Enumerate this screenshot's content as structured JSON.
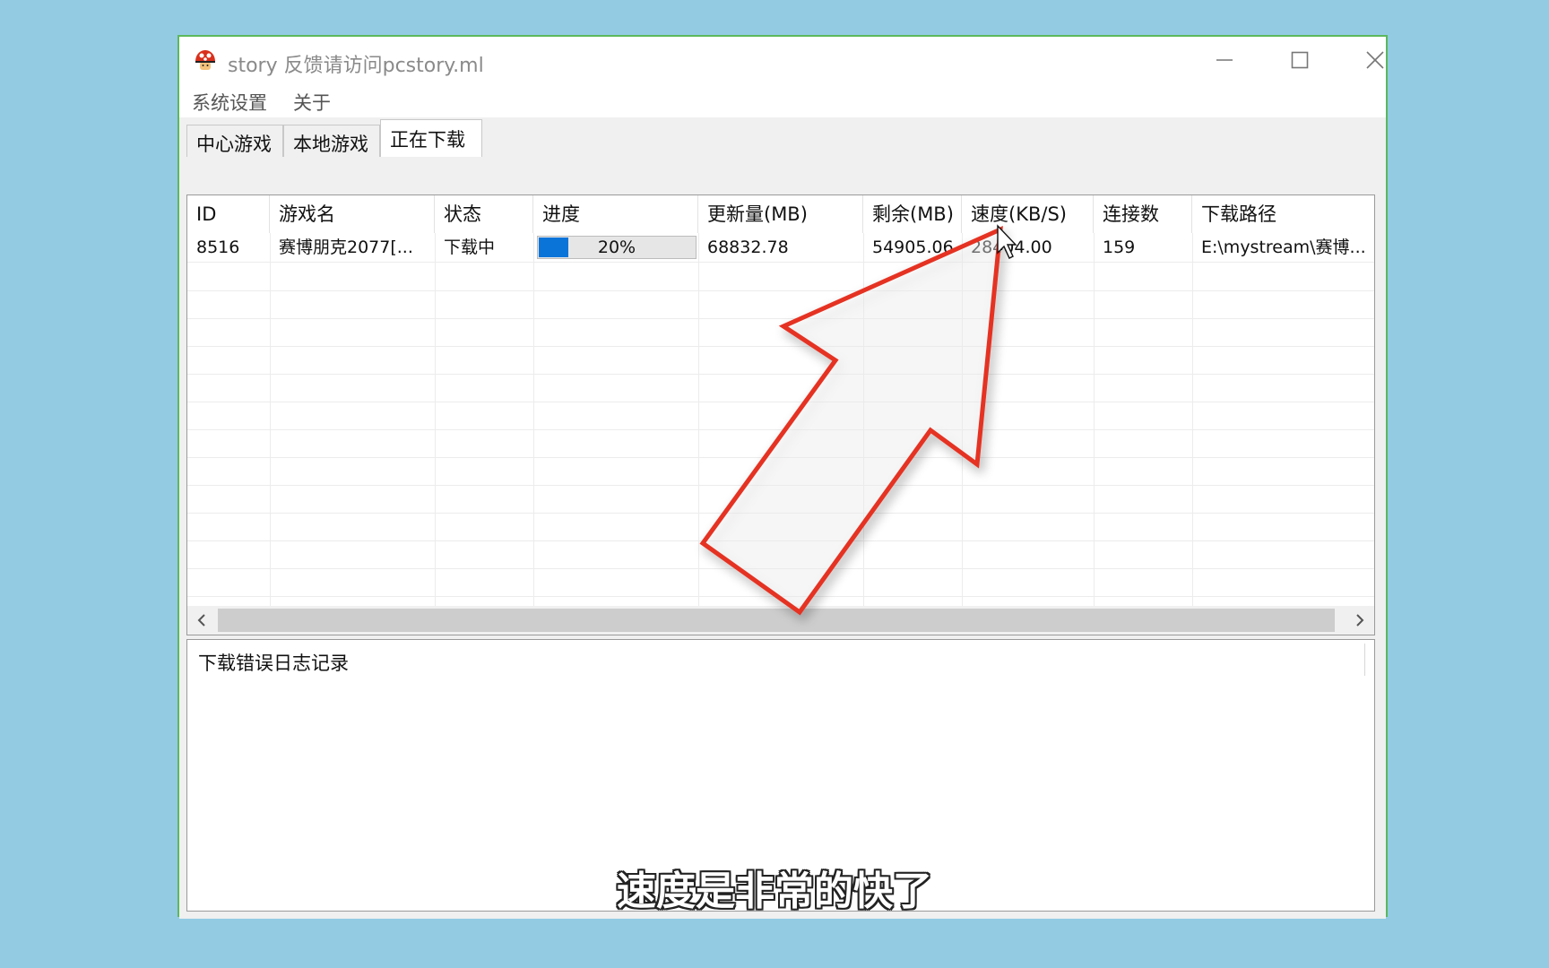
{
  "window": {
    "title": "story 反馈请访问pcstory.ml",
    "app_icon": "mushroom-icon"
  },
  "menu": {
    "items": [
      "系统设置",
      "关于"
    ]
  },
  "tabs": [
    {
      "label": "中心游戏",
      "active": false
    },
    {
      "label": "本地游戏",
      "active": false
    },
    {
      "label": "正在下载",
      "active": true
    }
  ],
  "table": {
    "columns": [
      "ID",
      "游戏名",
      "状态",
      "进度",
      "更新量(MB)",
      "剩余(MB)",
      "速度(KB/S)",
      "连接数",
      "下载路径"
    ],
    "rows": [
      {
        "id": "8516",
        "name": "赛博朋克2077[...",
        "status": "下载中",
        "progress": 20,
        "progress_text": "20%",
        "update_mb": "68832.78",
        "remaining_mb": "54905.06",
        "speed": "28404.00",
        "connections": "159",
        "path": "E:\\mystream\\赛博..."
      }
    ]
  },
  "log": {
    "label": "下载错误日志记录"
  },
  "overlay": {
    "subtitle": "速度是非常的快了",
    "arrow_color": "#e53322",
    "cursor_icon": "mouse-pointer-icon"
  },
  "colors": {
    "background": "#93cbe3",
    "window_border": "#5cb85c",
    "progress_fill": "#0a74d9"
  }
}
